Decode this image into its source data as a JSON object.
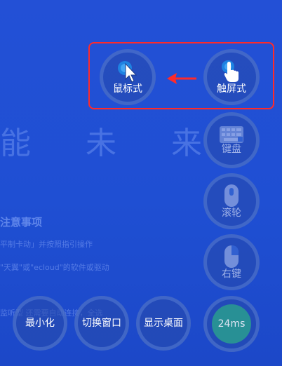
{
  "background": {
    "heading": "能 未 来",
    "subtitle": "注意事项",
    "line1": "平制卡动」并按照指引操作",
    "line2": "\"天翼\"或\"ecloud\"的软件或驱动",
    "line3": "监听型 还需要自动连接，全选"
  },
  "mode": {
    "mouse_label": "鼠标式",
    "touch_label": "触屏式"
  },
  "controls": {
    "keyboard_label": "键盘",
    "scroll_label": "滚轮",
    "right_click_label": "右键",
    "latency_label": "24ms"
  },
  "bottom": {
    "minimize_label": "最小化",
    "switch_window_label": "切换窗口",
    "show_desktop_label": "显示桌面"
  },
  "colors": {
    "accent": "#ff2a2a",
    "latency": "#2a9d8f"
  }
}
